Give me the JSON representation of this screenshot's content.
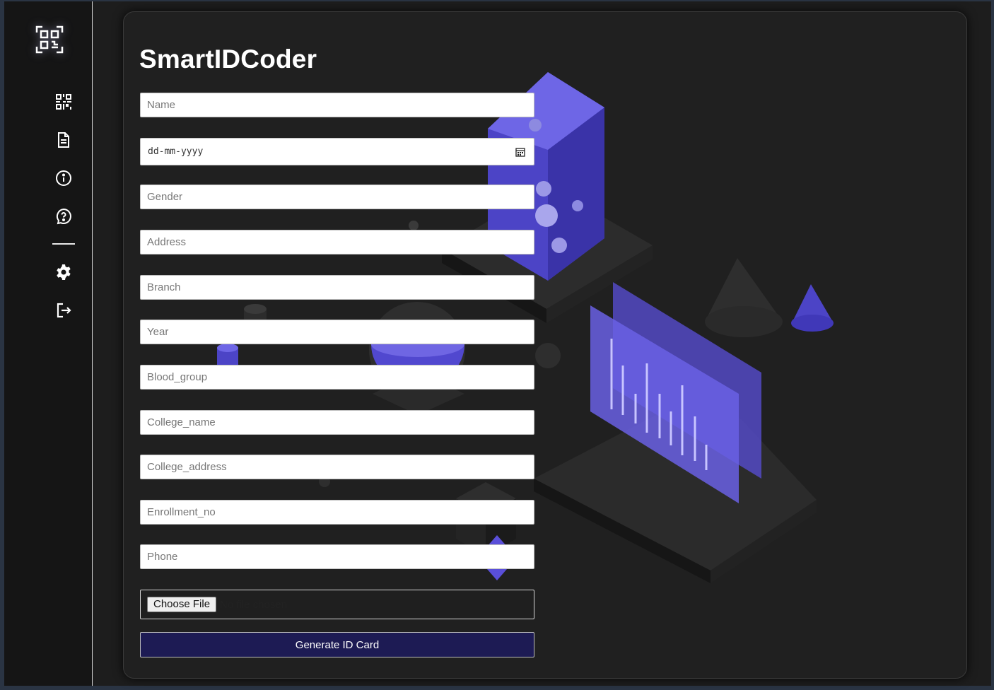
{
  "app": {
    "title": "SmartIDCoder"
  },
  "sidebar": {
    "items": [
      {
        "icon": "qr-code-icon"
      },
      {
        "icon": "document-icon"
      },
      {
        "icon": "info-icon"
      },
      {
        "icon": "help-icon"
      },
      {
        "icon": "settings-icon"
      },
      {
        "icon": "logout-icon"
      }
    ]
  },
  "form": {
    "name_placeholder": "Name",
    "dob_placeholder": "dd-mm-yyyy",
    "gender_placeholder": "Gender",
    "address_placeholder": "Address",
    "branch_placeholder": "Branch",
    "year_placeholder": "Year",
    "blood_group_placeholder": "Blood_group",
    "college_name_placeholder": "College_name",
    "college_address_placeholder": "College_address",
    "enrollment_no_placeholder": "Enrollment_no",
    "phone_placeholder": "Phone",
    "file_button_label": "Choose File",
    "file_status": "No file chosen",
    "submit_label": "Generate ID Card"
  },
  "colors": {
    "accent": "#1d1b54",
    "background": "#202020",
    "illustration": "#5a4fd9"
  }
}
